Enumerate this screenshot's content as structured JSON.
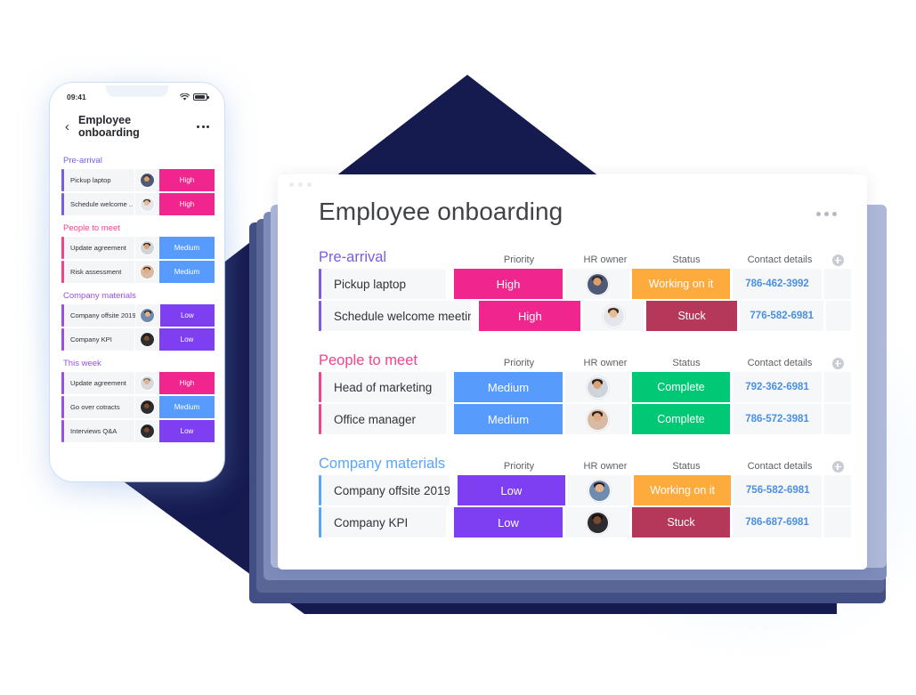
{
  "colors": {
    "navy": "#151a4f",
    "slate": "#6e7aa8",
    "high": "#e62e8b",
    "high_alt": "#f0258e",
    "medium": "#579bfc",
    "low": "#7e3ff2",
    "working": "#fdab3d",
    "stuck": "#b5385a",
    "complete": "#00c875",
    "link": "#4a90e2",
    "accent_prearrival": "#7b5ce0",
    "accent_people": "#f5418e",
    "accent_company": "#57a5fc",
    "accent_thisweek": "#9b4fe3"
  },
  "desktop": {
    "window_dots": [
      "dot",
      "dot",
      "dot"
    ],
    "title": "Employee onboarding",
    "kebab_label": "more-options",
    "column_headers": {
      "priority": "Priority",
      "owner": "HR owner",
      "status": "Status",
      "contact": "Contact details",
      "add": "+"
    },
    "groups": [
      {
        "title": "Pre-arrival",
        "title_color": "#7b5ce0",
        "accent": "#7b5ce0",
        "rows": [
          {
            "name": "Pickup laptop",
            "priority": "High",
            "priority_color": "#f0258e",
            "status": "Working on it",
            "status_color": "#fdab3d",
            "contact": "786-462-3992",
            "avatar_skin": "#d9a06a",
            "avatar_hair": "#2b2b33",
            "avatar_shirt": "#4e5a78"
          },
          {
            "name": "Schedule welcome meetin..",
            "priority": "High",
            "priority_color": "#f0258e",
            "status": "Stuck",
            "status_color": "#b5385a",
            "contact": "776-582-6981",
            "avatar_skin": "#e8bc93",
            "avatar_hair": "#3a2a1e",
            "avatar_shirt": "#e3e5ea"
          }
        ]
      },
      {
        "title": "People to meet",
        "title_color": "#f5418e",
        "accent": "#f5418e",
        "rows": [
          {
            "name": "Head of marketing",
            "priority": "Medium",
            "priority_color": "#579bfc",
            "status": "Complete",
            "status_color": "#00c875",
            "contact": "792-362-6981",
            "avatar_skin": "#d8a274",
            "avatar_hair": "#241b16",
            "avatar_shirt": "#cfd3da"
          },
          {
            "name": "Office manager",
            "priority": "Medium",
            "priority_color": "#579bfc",
            "status": "Complete",
            "status_color": "#00c875",
            "contact": "786-572-3981",
            "avatar_skin": "#e0ab7e",
            "avatar_hair": "#2e2119",
            "avatar_shirt": "#d7b9a4"
          }
        ]
      },
      {
        "title": "Company materials",
        "title_color": "#57a5fc",
        "accent": "#57a5fc",
        "rows": [
          {
            "name": "Company offsite 2019",
            "priority": "Low",
            "priority_color": "#7e3ff2",
            "status": "Working on it",
            "status_color": "#fdab3d",
            "contact": "756-582-6981",
            "avatar_skin": "#e2b189",
            "avatar_hair": "#1d1a1c",
            "avatar_shirt": "#6f8bb0"
          },
          {
            "name": "Company KPI",
            "priority": "Low",
            "priority_color": "#7e3ff2",
            "status": "Stuck",
            "status_color": "#b5385a",
            "contact": "786-687-6981",
            "avatar_skin": "#7a4a2c",
            "avatar_hair": "#15100e",
            "avatar_shirt": "#2c2c31"
          }
        ]
      }
    ]
  },
  "phone": {
    "status_bar": {
      "time": "09:41",
      "wifi_icon": "wifi-icon",
      "battery_icon": "battery-icon"
    },
    "header": {
      "back_icon": "‹",
      "title": "Employee onboarding",
      "kebab_label": "more-options"
    },
    "groups": [
      {
        "title": "Pre-arrival",
        "title_color": "#7b5ce0",
        "accent": "#7b5ce0",
        "rows": [
          {
            "name": "Pickup laptop",
            "priority": "High",
            "priority_color": "#f0258e",
            "avatar_skin": "#d9a06a",
            "avatar_hair": "#2b2b33",
            "avatar_shirt": "#4e5a78"
          },
          {
            "name": "Schedule welcome ..",
            "priority": "High",
            "priority_color": "#f0258e",
            "avatar_skin": "#e8bc93",
            "avatar_hair": "#3a2a1e",
            "avatar_shirt": "#e3e5ea"
          }
        ]
      },
      {
        "title": "People to meet",
        "title_color": "#f5418e",
        "accent": "#f5418e",
        "rows": [
          {
            "name": "Update agreement",
            "priority": "Medium",
            "priority_color": "#579bfc",
            "avatar_skin": "#d8a274",
            "avatar_hair": "#241b16",
            "avatar_shirt": "#cfd3da"
          },
          {
            "name": "Risk assessment",
            "priority": "Medium",
            "priority_color": "#579bfc",
            "avatar_skin": "#e0ab7e",
            "avatar_hair": "#2e2119",
            "avatar_shirt": "#d7b9a4"
          }
        ]
      },
      {
        "title": "Company materials",
        "title_color": "#9b4fe3",
        "accent": "#9b4fe3",
        "rows": [
          {
            "name": "Company offsite 2019",
            "priority": "Low",
            "priority_color": "#7e3ff2",
            "avatar_skin": "#e2b189",
            "avatar_hair": "#1d1a1c",
            "avatar_shirt": "#6f8bb0"
          },
          {
            "name": "Company KPI",
            "priority": "Low",
            "priority_color": "#7e3ff2",
            "avatar_skin": "#7a4a2c",
            "avatar_hair": "#15100e",
            "avatar_shirt": "#2c2c31"
          }
        ]
      },
      {
        "title": "This week",
        "title_color": "#9b4fe3",
        "accent": "#9b4fe3",
        "rows": [
          {
            "name": "Update agreement",
            "priority": "High",
            "priority_color": "#f0258e",
            "avatar_skin": "#e3b48d",
            "avatar_hair": "#6b6f76",
            "avatar_shirt": "#d6d9de"
          },
          {
            "name": "Go over cotracts",
            "priority": "Medium",
            "priority_color": "#579bfc",
            "avatar_skin": "#7a4a2c",
            "avatar_hair": "#15100e",
            "avatar_shirt": "#2c2c31"
          },
          {
            "name": "Interviews Q&A",
            "priority": "Low",
            "priority_color": "#7e3ff2",
            "avatar_skin": "#7a4a2c",
            "avatar_hair": "#15100e",
            "avatar_shirt": "#2c2c31"
          }
        ]
      }
    ]
  }
}
